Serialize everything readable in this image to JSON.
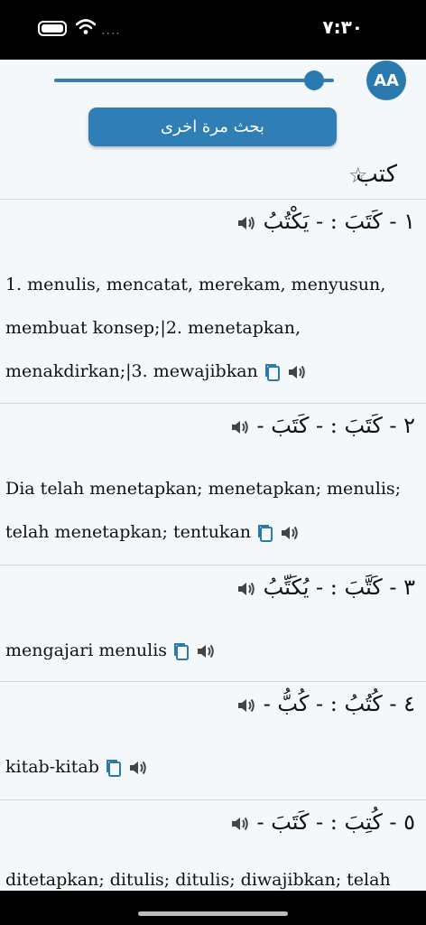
{
  "status": {
    "time": "٧:٣٠",
    "signal_dots": "...."
  },
  "toolbar": {
    "font_button_label": "AA",
    "font_size_level": 0.93,
    "search_again_label": "بحث مرة اخرى"
  },
  "word": {
    "title": "كتب",
    "favorite": false
  },
  "entries": [
    {
      "arabic": "١ - كَتَبَ : - يَكْتُبُ",
      "meaning": "1. menulis, mencatat, merekam, menyusun, membuat konsep;|2. menetapkan, menakdirkan;|3. mewajibkan"
    },
    {
      "arabic": "٢ - كَتَبَ : - كَتَبَ -",
      "meaning": "Dia telah menetapkan; menetapkan; menulis; telah menetapkan; tentukan"
    },
    {
      "arabic": "٣ - كَتَّبَ : - يُكَتِّبُ",
      "meaning": "mengajari menulis"
    },
    {
      "arabic": "٤ - كُتُبُ : - كُبُّ -",
      "meaning": "kitab-kitab"
    },
    {
      "arabic": "٥ - كُتِبَ : - كَتَبَ -",
      "meaning": "ditetapkan; ditulis; ditulis; diwajibkan; telah"
    }
  ],
  "icons": {
    "copy": "copy-icon",
    "speaker": "speaker-icon",
    "star": "star-outline-icon",
    "accent": "#2a7ab0"
  }
}
